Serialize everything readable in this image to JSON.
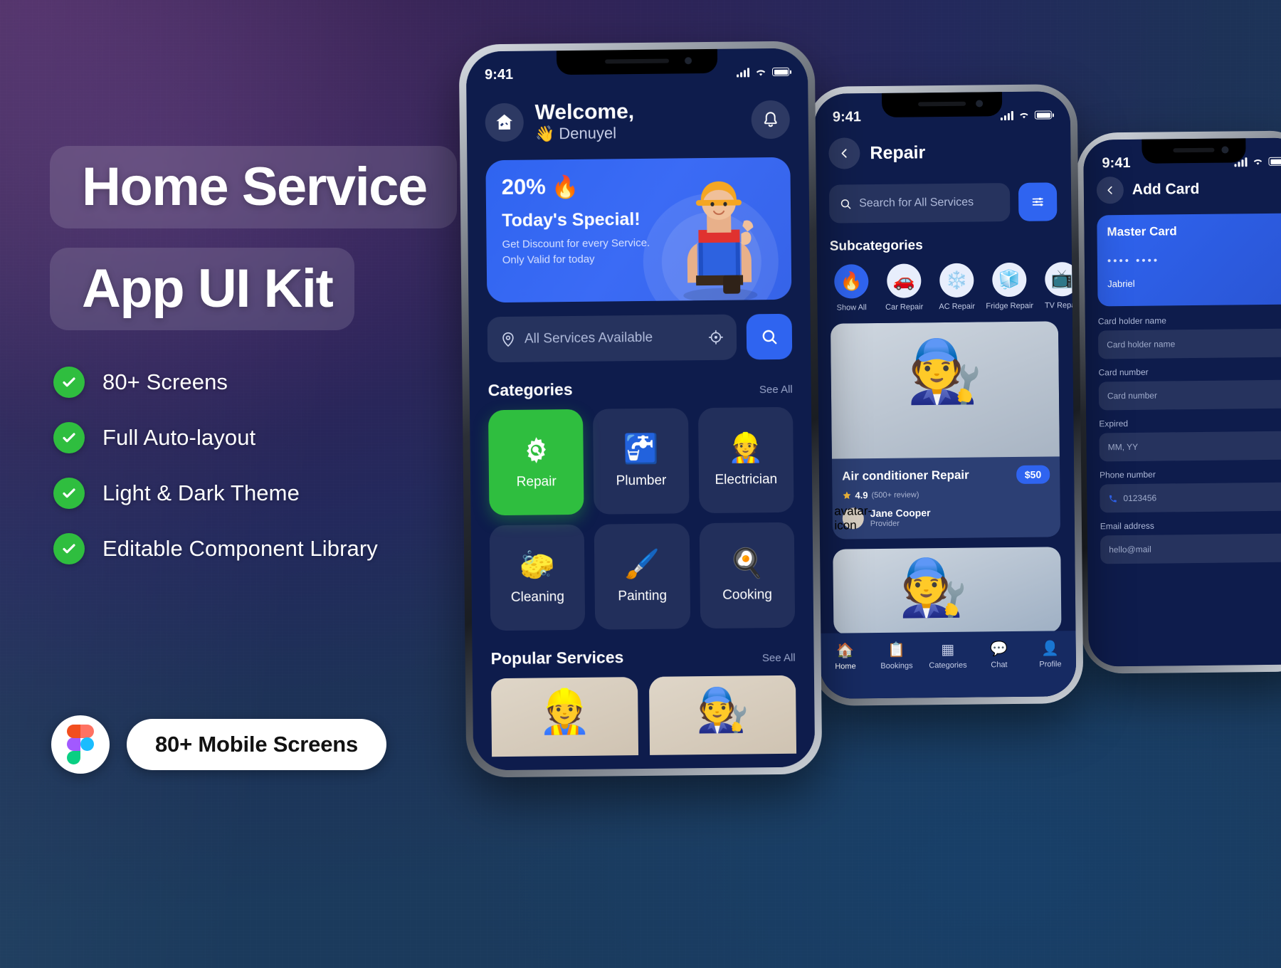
{
  "hero": {
    "title_line1": "Home Service",
    "title_line2": "App UI Kit",
    "features": [
      {
        "label": "80+ Screens",
        "icon": "check-icon"
      },
      {
        "label": "Full Auto-layout",
        "icon": "check-icon"
      },
      {
        "label": "Light & Dark Theme",
        "icon": "check-icon"
      },
      {
        "label": "Editable Component Library",
        "icon": "check-icon"
      }
    ],
    "badge": {
      "logo": "figma-logo",
      "label": "80+ Mobile Screens"
    },
    "colors": {
      "check_green": "#2fbe3f",
      "accent_blue": "#2f64f0",
      "chip_bg": "rgba(255,255,255,0.13)"
    }
  },
  "phone1": {
    "status": {
      "time": "9:41",
      "signal": "signal-bars-icon",
      "wifi": "wifi-icon",
      "battery": "battery-icon"
    },
    "header": {
      "home_icon": "home-tools-icon",
      "welcome": "Welcome,",
      "wave": "👋",
      "username": "Denuyel",
      "bell": "bell-icon"
    },
    "promo": {
      "percent": "20%",
      "fire": "🔥",
      "title": "Today's Special!",
      "subtitle": "Get Discount for every Service. Only Valid for today",
      "worker": "worker-illustration"
    },
    "search": {
      "location_icon": "location-pin-icon",
      "location_text": "All Services Available",
      "target_icon": "crosshair-icon",
      "search_icon": "search-icon"
    },
    "categories_section": {
      "title": "Categories",
      "see_all": "See All"
    },
    "categories": [
      {
        "label": "Repair",
        "icon": "⚙️",
        "active": true
      },
      {
        "label": "Plumber",
        "icon": "🚰",
        "active": false
      },
      {
        "label": "Electrician",
        "icon": "👷",
        "active": false
      },
      {
        "label": "Cleaning",
        "icon": "🧽",
        "active": false
      },
      {
        "label": "Painting",
        "icon": "🖌️",
        "active": false
      },
      {
        "label": "Cooking",
        "icon": "🍳",
        "active": false
      }
    ],
    "popular_section": {
      "title": "Popular Services",
      "see_all": "See All"
    },
    "popular_cards": [
      {
        "image": "👷"
      },
      {
        "image": "🧑‍🔧"
      }
    ]
  },
  "phone2": {
    "status": {
      "time": "9:41"
    },
    "header": {
      "back": "chevron-left-icon",
      "title": "Repair"
    },
    "search": {
      "icon": "search-icon",
      "placeholder": "Search for All Services",
      "filter_icon": "filter-sliders-icon"
    },
    "subcategories_title": "Subcategories",
    "subcategories": [
      {
        "label": "Show All",
        "icon": "🔥"
      },
      {
        "label": "Car Repair",
        "icon": "🚗"
      },
      {
        "label": "AC Repair",
        "icon": "❄️"
      },
      {
        "label": "Fridge Repair",
        "icon": "🧊"
      },
      {
        "label": "TV Repair",
        "icon": "📺"
      }
    ],
    "service_card": {
      "image": "🧑‍🔧",
      "name": "Air conditioner Repair",
      "price": "$50",
      "star": "star-icon",
      "rating": "4.9",
      "review_count": "(500+ review)",
      "provider_avatar": "avatar-icon",
      "provider_name": "Jane Cooper",
      "provider_role": "Provider"
    },
    "service_card_2": {
      "image": "🧑‍🔧"
    },
    "tabs": [
      {
        "label": "Home",
        "icon": "🏠",
        "active": true
      },
      {
        "label": "Bookings",
        "icon": "📋",
        "active": false
      },
      {
        "label": "Categories",
        "icon": "▦",
        "active": false
      },
      {
        "label": "Chat",
        "icon": "💬",
        "active": false
      },
      {
        "label": "Profile",
        "icon": "👤",
        "active": false
      }
    ]
  },
  "phone3": {
    "status": {
      "time": "9:41"
    },
    "header": {
      "back": "chevron-left-icon",
      "title": "Add Card"
    },
    "card": {
      "label": "Master Card",
      "number": "••••  ••••",
      "holder": "Jabriel"
    },
    "fields": [
      {
        "label": "Card holder name",
        "value": "Card holder name"
      },
      {
        "label": "Card number",
        "value": "Card number"
      },
      {
        "label": "Expired",
        "value": "MM, YY"
      },
      {
        "label": "Phone number",
        "value": "0123456"
      },
      {
        "label": "Email address",
        "value": "hello@mail"
      }
    ]
  }
}
